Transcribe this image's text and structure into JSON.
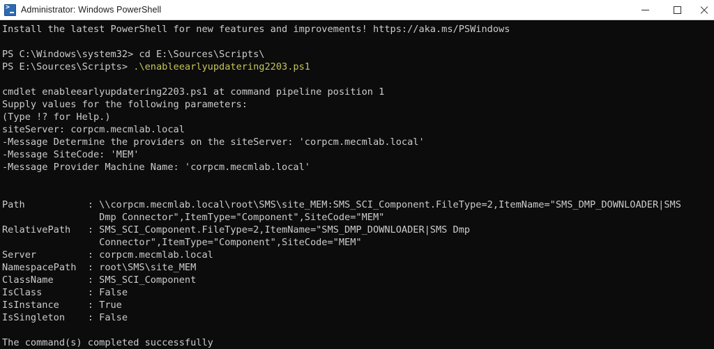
{
  "window": {
    "title": "Administrator: Windows PowerShell",
    "icon": "powershell-icon",
    "background_color": "#0c0c0c",
    "text_color": "#cccccc",
    "titlebar_color": "#ffffff",
    "controls": {
      "minimize_label": "Minimize",
      "maximize_label": "Maximize",
      "close_label": "Close"
    }
  },
  "console": {
    "prompt_script_color": "#c5c55a",
    "lines": [
      {
        "text": "Install the latest PowerShell for new features and improvements! https://aka.ms/PSWindows",
        "style": "default"
      },
      {
        "text": "",
        "style": "blank"
      },
      {
        "text": "PS C:\\Windows\\system32> cd E:\\Sources\\Scripts\\",
        "style": "default"
      },
      {
        "text": "PS E:\\Sources\\Scripts> ",
        "style": "default",
        "suffix": ".\\enableearlyupdatering2203.ps1",
        "suffix_style": "script"
      },
      {
        "text": "",
        "style": "blank"
      },
      {
        "text": "cmdlet enableearlyupdatering2203.ps1 at command pipeline position 1",
        "style": "default"
      },
      {
        "text": "Supply values for the following parameters:",
        "style": "default"
      },
      {
        "text": "(Type !? for Help.)",
        "style": "default"
      },
      {
        "text": "siteServer: corpcm.mecmlab.local",
        "style": "default"
      },
      {
        "text": "-Message Determine the providers on the siteServer: 'corpcm.mecmlab.local'",
        "style": "default"
      },
      {
        "text": "-Message SiteCode: 'MEM'",
        "style": "default"
      },
      {
        "text": "-Message Provider Machine Name: 'corpcm.mecmlab.local'",
        "style": "default"
      },
      {
        "text": "",
        "style": "blank"
      },
      {
        "text": "",
        "style": "blank"
      },
      {
        "text": "Path           : \\\\corpcm.mecmlab.local\\root\\SMS\\site_MEM:SMS_SCI_Component.FileType=2,ItemName=\"SMS_DMP_DOWNLOADER|SMS",
        "style": "default"
      },
      {
        "text": "                 Dmp Connector\",ItemType=\"Component\",SiteCode=\"MEM\"",
        "style": "default"
      },
      {
        "text": "RelativePath   : SMS_SCI_Component.FileType=2,ItemName=\"SMS_DMP_DOWNLOADER|SMS Dmp",
        "style": "default"
      },
      {
        "text": "                 Connector\",ItemType=\"Component\",SiteCode=\"MEM\"",
        "style": "default"
      },
      {
        "text": "Server         : corpcm.mecmlab.local",
        "style": "default"
      },
      {
        "text": "NamespacePath  : root\\SMS\\site_MEM",
        "style": "default"
      },
      {
        "text": "ClassName      : SMS_SCI_Component",
        "style": "default"
      },
      {
        "text": "IsClass        : False",
        "style": "default"
      },
      {
        "text": "IsInstance     : True",
        "style": "default"
      },
      {
        "text": "IsSingleton    : False",
        "style": "default"
      },
      {
        "text": "",
        "style": "blank"
      },
      {
        "text": "The command(s) completed successfully",
        "style": "default"
      }
    ]
  }
}
